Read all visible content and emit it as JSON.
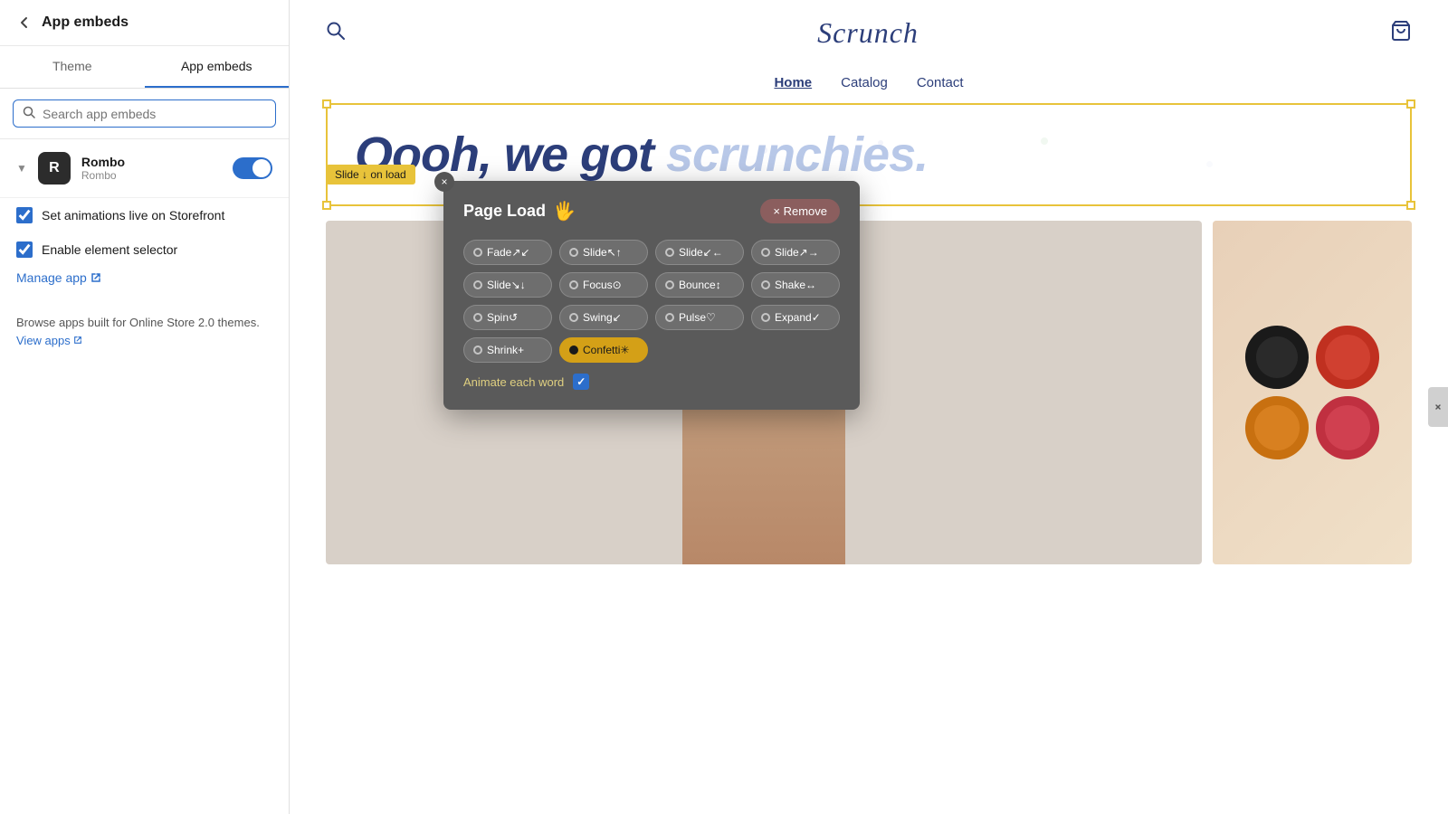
{
  "sidebar": {
    "title": "App embeds",
    "back_label": "←",
    "tabs": [
      {
        "label": "Theme",
        "active": false
      },
      {
        "label": "App embeds",
        "active": true
      }
    ],
    "search_placeholder": "Search app embeds",
    "embed": {
      "name": "Rombo",
      "sub": "Rombo",
      "icon_letter": "R",
      "toggle_on": true
    },
    "checkboxes": [
      {
        "id": "cb1",
        "label": "Set animations live on Storefront",
        "checked": true
      },
      {
        "id": "cb2",
        "label": "Enable element selector",
        "checked": true
      }
    ],
    "manage_link_label": "Manage app",
    "browse_text": "Browse apps built for Online Store 2.0 themes.",
    "view_apps_label": "View apps"
  },
  "storefront": {
    "logo": "Scrunch",
    "nav_links": [
      {
        "label": "Home",
        "active": true
      },
      {
        "label": "Catalog",
        "active": false
      },
      {
        "label": "Contact",
        "active": false
      }
    ],
    "hero_text": "Oooh, we got scrunchies.",
    "hero_words": [
      "Oooh,",
      "we",
      "got",
      "scrunchies."
    ],
    "slide_badge": "Slide ↓ on load"
  },
  "popup": {
    "title": "Page Load",
    "emoji": "🖐️",
    "remove_label": "× Remove",
    "close_symbol": "×",
    "animations": [
      {
        "label": "Fade↗↙",
        "selected": false
      },
      {
        "label": "Slide↖↑",
        "selected": false
      },
      {
        "label": "Slide↙←",
        "selected": false
      },
      {
        "label": "Slide↗→",
        "selected": false
      },
      {
        "label": "Slide↘↓",
        "selected": false
      },
      {
        "label": "Focus⊙",
        "selected": false
      },
      {
        "label": "Bounce↕",
        "selected": false
      },
      {
        "label": "Shake↔",
        "selected": false
      },
      {
        "label": "Spin↺",
        "selected": false
      },
      {
        "label": "Swing↙",
        "selected": false
      },
      {
        "label": "Pulse♡",
        "selected": false
      },
      {
        "label": "Expand✓",
        "selected": false
      },
      {
        "label": "Shrink+",
        "selected": false
      },
      {
        "label": "Confetti✳",
        "selected": true
      }
    ],
    "animate_each_word_label": "Animate each word",
    "animate_each_word_checked": true
  },
  "colors": {
    "accent_blue": "#2c6ecb",
    "accent_yellow": "#e8c33a",
    "hero_blue_dark": "#2c3e7a",
    "hero_blue_light": "#b8c8e8",
    "popup_bg": "#5a5a5a",
    "popup_selected": "#d4a017"
  }
}
